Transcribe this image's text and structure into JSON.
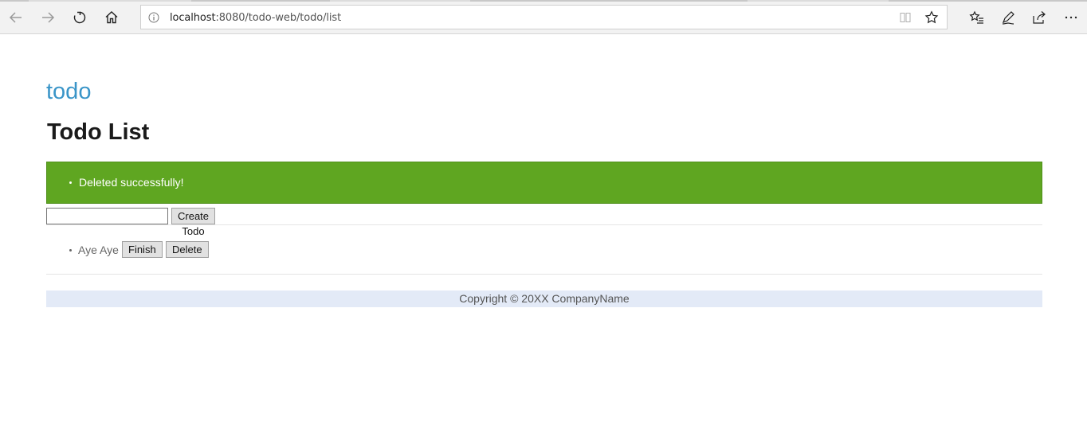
{
  "browser": {
    "url_host": "localhost",
    "url_rest": ":8080/todo-web/todo/list",
    "icons": {
      "back": "back-arrow-icon",
      "forward": "forward-arrow-icon",
      "refresh": "refresh-icon",
      "home": "home-icon",
      "site_info": "info-icon",
      "reading_view": "reading-view-icon",
      "favorite": "star-icon",
      "favorites_list": "favorites-list-icon",
      "pen": "pen-icon",
      "share": "share-icon",
      "more": "more-icon"
    }
  },
  "page": {
    "brand": "todo",
    "title": "Todo List",
    "alert": {
      "messages": [
        "Deleted successfully!"
      ],
      "color": "#5fa621"
    },
    "form": {
      "input_value": "",
      "create_label": "Create Todo"
    },
    "todos": [
      {
        "title": "Aye Aye",
        "finish_label": "Finish",
        "delete_label": "Delete"
      }
    ],
    "footer": "Copyright © 20XX CompanyName"
  },
  "colors": {
    "brand": "#3a95c8",
    "footer_bg": "#e3eaf7"
  }
}
